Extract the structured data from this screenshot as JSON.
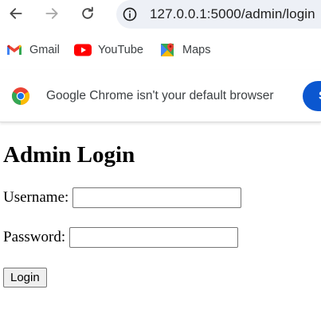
{
  "browser": {
    "url": "127.0.0.1:5000/admin/login",
    "bookmarks": [
      {
        "label": "Gmail",
        "icon": "gmail-icon"
      },
      {
        "label": "YouTube",
        "icon": "youtube-icon"
      },
      {
        "label": "Maps",
        "icon": "maps-icon"
      }
    ],
    "infobar": {
      "message": "Google Chrome isn't your default browser",
      "button_label": "Set as default"
    },
    "colors": {
      "omnibox_bg": "#edf0f6",
      "accent_blue": "#0b57d0"
    }
  },
  "page": {
    "title": "Admin Login",
    "username_label": "Username:",
    "username_value": "",
    "password_label": "Password:",
    "password_value": "",
    "login_button": "Login"
  }
}
